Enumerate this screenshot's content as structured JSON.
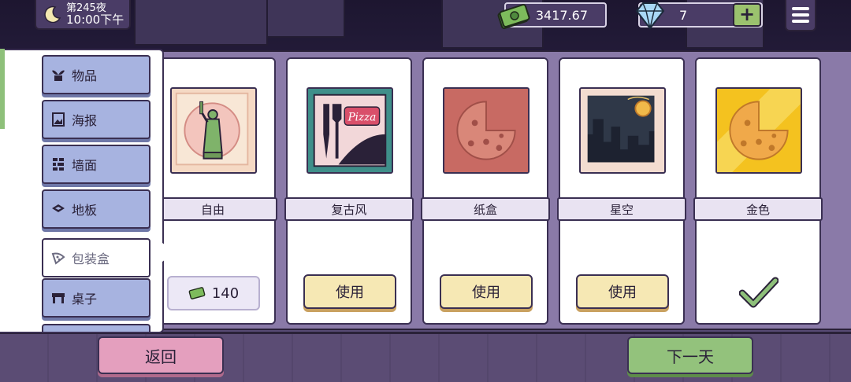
{
  "hud": {
    "day": "第245夜",
    "time": "10:00下午",
    "money": "3417.67",
    "gems": "7",
    "plus": "+"
  },
  "categories": [
    {
      "label": "物品",
      "icon": "plant-icon"
    },
    {
      "label": "海报",
      "icon": "poster-icon"
    },
    {
      "label": "墙面",
      "icon": "brick-wall-icon"
    },
    {
      "label": "地板",
      "icon": "floor-tiles-icon"
    },
    {
      "label": "包装盒",
      "icon": "pizza-slice-icon",
      "active": true
    },
    {
      "label": "桌子",
      "icon": "table-icon"
    }
  ],
  "items": [
    {
      "name": "自由",
      "action": "price",
      "price": "140",
      "image": "statue-of-liberty"
    },
    {
      "name": "复古风",
      "action": "use",
      "button": "使用",
      "image": "retro-pizza-box"
    },
    {
      "name": "纸盒",
      "action": "use",
      "button": "使用",
      "image": "cardboard-pizza-box"
    },
    {
      "name": "星空",
      "action": "use",
      "button": "使用",
      "image": "night-skyline-box"
    },
    {
      "name": "金色",
      "action": "selected",
      "image": "gold-pizza-box"
    }
  ],
  "footer": {
    "back": "返回",
    "next": "下一天"
  },
  "colors": {
    "panel": "#8a7aa8",
    "category_button": "#a7b3e0",
    "use_button": "#f6e8b4",
    "back_button": "#e49fbe",
    "next_button": "#93c27c"
  }
}
